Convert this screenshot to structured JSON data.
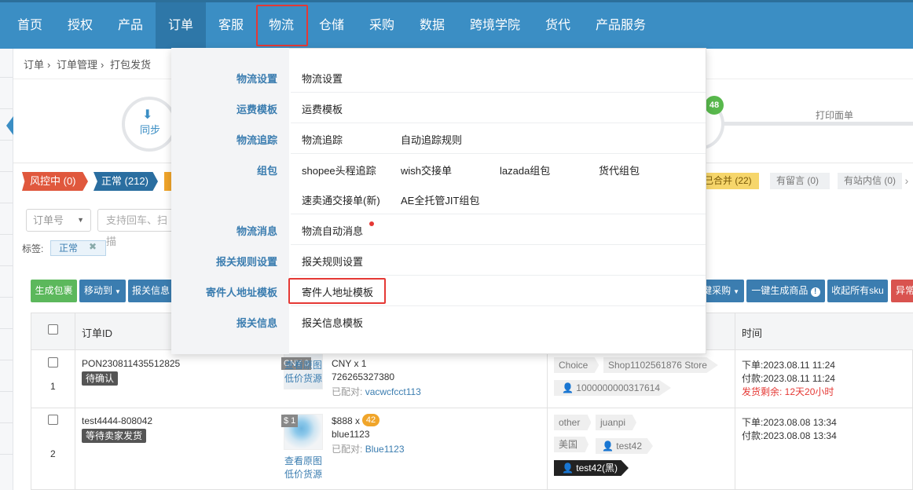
{
  "nav": {
    "items": [
      "首页",
      "授权",
      "产品",
      "订单",
      "客服",
      "物流",
      "仓储",
      "采购",
      "数据",
      "跨境学院",
      "货代",
      "产品服务"
    ],
    "active": "订单",
    "highlighted": "物流"
  },
  "breadcrumb": [
    "订单",
    "订单管理",
    "打包发货"
  ],
  "steps": {
    "sync_label": "同步",
    "badge_count": "48",
    "print_label": "打印面单"
  },
  "status_tags": {
    "risk": "风控中 (0)",
    "normal": "正常 (212)",
    "merged": "已合并 (22)",
    "has_message": "有留言 (0)",
    "station_message": "有站内信 (0)"
  },
  "filter": {
    "select_value": "订单号",
    "input_placeholder": "支持回车、扫描"
  },
  "label_filter": {
    "label": "标签:",
    "chip": "正常"
  },
  "toolbar": {
    "create_package": "生成包裹",
    "move_to": "移动到",
    "customs_info": "报关信息",
    "purchase": "键采购",
    "gen_product": "一键生成商品",
    "collapse_sku": "收起所有sku",
    "exception": "异常"
  },
  "table": {
    "col_order_id": "订单ID",
    "col_time": "时间",
    "rows": [
      {
        "index": "1",
        "order_id": "PON230811435512825",
        "status": "待确认",
        "price_tag": "CNY 0",
        "view_image": "查看原图",
        "low_price": "低价货源",
        "currency": "CNY",
        "qty": "x 1",
        "sku": "726265327380",
        "matched_label": "已配对:",
        "matched_value": "vacwcfcct113",
        "tags": [
          "Choice",
          "Shop1102561876 Store"
        ],
        "buyer": "1000000000317614",
        "placed": "下单:2023.08.11 11:24",
        "paid": "付款:2023.08.11 11:24",
        "remaining": "发货剩余: 12天20小时"
      },
      {
        "index": "2",
        "order_id": "test4444-808042",
        "status": "等待卖家发货",
        "price_tag": "$ 1",
        "view_image": "查看原图",
        "low_price": "低价货源",
        "price": "$888",
        "qty": "x",
        "qty_badge": "42",
        "sku": "blue1123",
        "matched_label": "已配对:",
        "matched_value": "Blue1123",
        "tags": [
          "other",
          "juanpi"
        ],
        "country": "美国",
        "buyer": "test42",
        "buyer_black": "test42(黑)",
        "placed": "下单:2023.08.08 13:34",
        "paid": "付款:2023.08.08 13:34"
      }
    ]
  },
  "dropdown": {
    "categories": [
      {
        "name": "物流设置",
        "items": [
          "物流设置"
        ]
      },
      {
        "name": "运费模板",
        "items": [
          "运费模板"
        ]
      },
      {
        "name": "物流追踪",
        "items": [
          "物流追踪",
          "自动追踪规则"
        ]
      },
      {
        "name": "组包",
        "items": [
          "shopee头程追踪",
          "wish交接单",
          "lazada组包",
          "货代组包",
          "速卖通交接单(新)",
          "AE全托管JIT组包"
        ]
      },
      {
        "name": "物流消息",
        "items": [
          "物流自动消息"
        ]
      },
      {
        "name": "报关规则设置",
        "items": [
          "报关规则设置"
        ]
      },
      {
        "name": "寄件人地址模板",
        "items": [
          "寄件人地址模板"
        ]
      },
      {
        "name": "报关信息",
        "items": [
          "报关信息模板"
        ]
      }
    ]
  },
  "colors": {
    "nav_bg": "#3b8ec4",
    "accent": "#3b7db0",
    "highlight_red": "#e53935",
    "green": "#58b84c"
  }
}
